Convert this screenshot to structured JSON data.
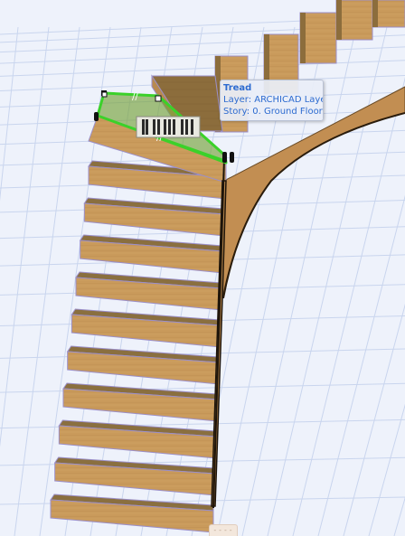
{
  "colors": {
    "background": "#eef2fb",
    "grid": "#c9d5ee",
    "wood": "#c99a5b",
    "wood_dark": "#9a7643",
    "tread_top": "#7a6a44",
    "edge": "#9b8fc9",
    "selection": "#3bd12a",
    "tooltip_text": "#2d6bd0"
  },
  "tooltip": {
    "title": "Tread",
    "layer": "Layer: ARCHICAD Layer",
    "story": "Story: 0. Ground Floor"
  },
  "edit_palette": {
    "icon": "pet-palette-icon"
  },
  "bottom_handle": {
    "label": "----"
  }
}
